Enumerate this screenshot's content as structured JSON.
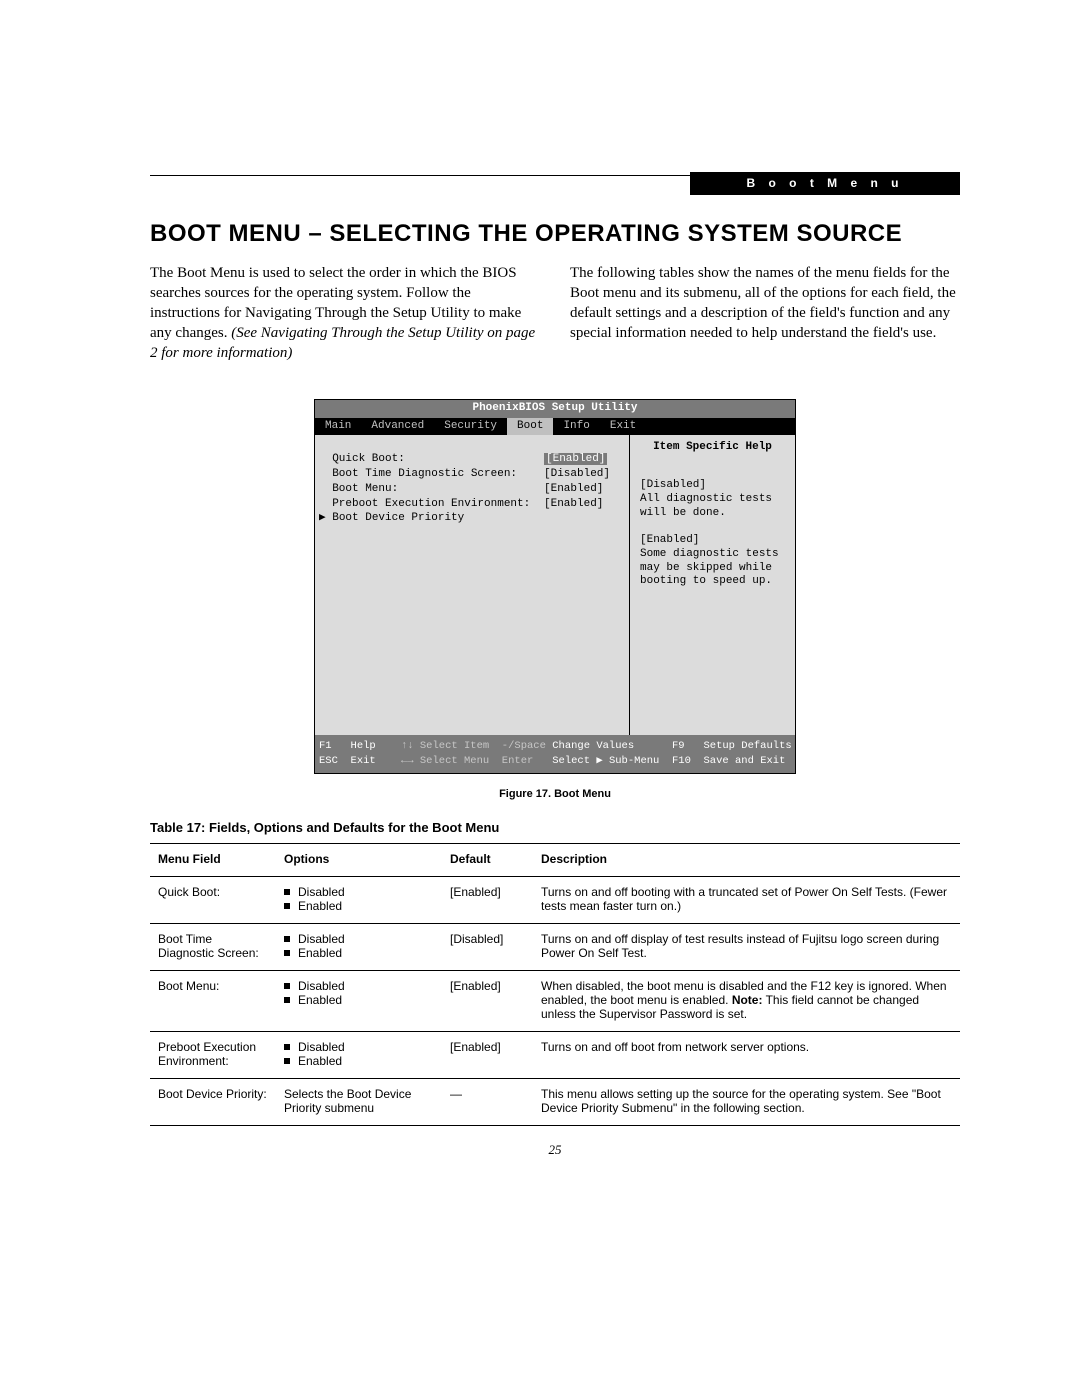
{
  "header": {
    "label": "B o o t   M e n u"
  },
  "heading": "BOOT MENU – SELECTING THE OPERATING SYSTEM SOURCE",
  "intro": {
    "left_plain": "The Boot Menu is used to select the order in which the BIOS searches sources for the operating system. Follow the instructions for Navigating Through the Setup Utility to make any changes. ",
    "left_italic": "(See Navigating Through the Setup Utility on page 2 for more information)",
    "right": "The following tables show the names of the menu fields for the Boot menu and its submenu, all of the options for each field, the default settings and a description of the field's function and any special information needed to help understand the field's use."
  },
  "bios": {
    "title": "PhoenixBIOS Setup Utility",
    "tabs": [
      "Main",
      "Advanced",
      "Security",
      "Boot",
      "Info",
      "Exit"
    ],
    "active_tab_index": 3,
    "rows": [
      {
        "label": "Quick Boot:",
        "value": "[Enabled]",
        "selected": true,
        "arrow": false
      },
      {
        "label": "Boot Time Diagnostic Screen:",
        "value": "[Disabled]",
        "selected": false,
        "arrow": false
      },
      {
        "label": "Boot Menu:",
        "value": "[Enabled]",
        "selected": false,
        "arrow": false
      },
      {
        "label": "Preboot Execution Environment:",
        "value": "[Enabled]",
        "selected": false,
        "arrow": false
      },
      {
        "label": "Boot Device Priority",
        "value": "",
        "selected": false,
        "arrow": true
      }
    ],
    "help_title": "Item Specific Help",
    "help_text": "[Disabled]\nAll diagnostic tests will be done.\n\n[Enabled]\nSome diagnostic tests may be skipped while booting to speed up.",
    "footer": {
      "row1": {
        "a_key": "F1",
        "a_txt": "Help",
        "b_key": "↑↓",
        "b_txt": "Select Item",
        "c_key": "-/Space",
        "c_txt": "Change Values",
        "d_key": "F9",
        "d_txt": "Setup Defaults"
      },
      "row2": {
        "a_key": "ESC",
        "a_txt": "Exit",
        "b_key": "←→",
        "b_txt": "Select Menu",
        "c_key": "Enter",
        "c_txt": "Select ▶ Sub-Menu",
        "d_key": "F10",
        "d_txt": "Save and Exit"
      }
    }
  },
  "figure_caption": "Figure 17.  Boot Menu",
  "table": {
    "title": "Table 17: Fields, Options and Defaults for the Boot Menu",
    "headers": [
      "Menu Field",
      "Options",
      "Default",
      "Description"
    ],
    "rows": [
      {
        "field": "Quick Boot:",
        "options": [
          "Disabled",
          "Enabled"
        ],
        "default": "[Enabled]",
        "desc": "Turns on and off booting with a truncated set of Power On Self Tests. (Fewer tests mean faster turn on.)"
      },
      {
        "field": "Boot Time Diagnostic Screen:",
        "options": [
          "Disabled",
          "Enabled"
        ],
        "default": "[Disabled]",
        "desc": "Turns on and off display of test results instead of Fujitsu logo screen during Power On Self Test."
      },
      {
        "field": "Boot Menu:",
        "options": [
          "Disabled",
          "Enabled"
        ],
        "default": "[Enabled]",
        "desc_pre": "When disabled, the boot menu is disabled and the F12 key is ignored. When enabled, the boot menu is enabled. ",
        "desc_bold": "Note:",
        "desc_post": " This field cannot be changed unless the Supervisor Password is set."
      },
      {
        "field": "Preboot Execution Environment:",
        "options": [
          "Disabled",
          "Enabled"
        ],
        "default": "[Enabled]",
        "desc": "Turns on and off boot from network server options."
      },
      {
        "field": "Boot Device Priority:",
        "options_text": "Selects the Boot Device Priority submenu",
        "default": "—",
        "desc": "This menu allows setting up the source for the operating system. See \"Boot Device Priority Submenu\" in the following section."
      }
    ]
  },
  "page_number": "25"
}
